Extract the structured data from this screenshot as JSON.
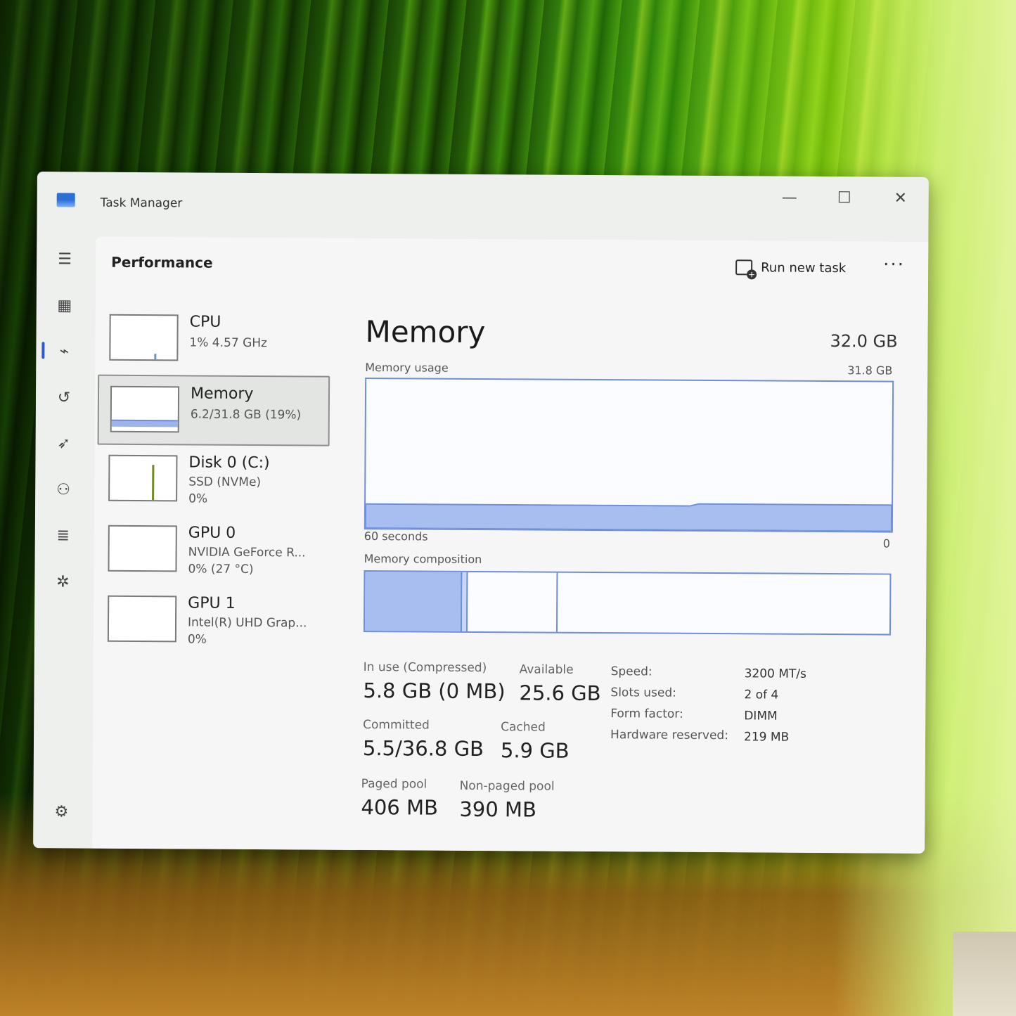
{
  "window": {
    "title": "Task Manager",
    "controls": {
      "minimize": "—",
      "maximize": "☐",
      "close": "✕"
    }
  },
  "nav": {
    "items": [
      {
        "name": "hamburger-menu-icon",
        "glyph": "☰"
      },
      {
        "name": "processes-icon",
        "glyph": "▦"
      },
      {
        "name": "performance-icon",
        "glyph": "⌁"
      },
      {
        "name": "app-history-icon",
        "glyph": "↺"
      },
      {
        "name": "startup-apps-icon",
        "glyph": "➶"
      },
      {
        "name": "users-icon",
        "glyph": "⚇"
      },
      {
        "name": "details-icon",
        "glyph": "≣"
      },
      {
        "name": "services-icon",
        "glyph": "✲"
      },
      {
        "name": "settings-icon",
        "glyph": "⚙"
      }
    ]
  },
  "header": {
    "section": "Performance",
    "run_new_task": "Run new task",
    "more": "···"
  },
  "devices": [
    {
      "name": "CPU",
      "line1": "1% 4.57 GHz",
      "line2": ""
    },
    {
      "name": "Memory",
      "line1": "6.2/31.8 GB (19%)",
      "line2": ""
    },
    {
      "name": "Disk 0 (C:)",
      "line1": "SSD (NVMe)",
      "line2": "0%"
    },
    {
      "name": "GPU 0",
      "line1": "NVIDIA GeForce R...",
      "line2": "0% (27 °C)"
    },
    {
      "name": "GPU 1",
      "line1": "Intel(R) UHD Grap...",
      "line2": "0%"
    }
  ],
  "memory": {
    "title": "Memory",
    "total": "32.0 GB",
    "usage_label": "Memory usage",
    "usage_max": "31.8 GB",
    "axis_left": "60 seconds",
    "axis_right": "0",
    "composition_label": "Memory composition",
    "usage_fraction": 0.19,
    "stats": {
      "in_use_label": "In use (Compressed)",
      "in_use_value": "5.8 GB (0 MB)",
      "available_label": "Available",
      "available_value": "25.6 GB",
      "committed_label": "Committed",
      "committed_value": "5.5/36.8 GB",
      "cached_label": "Cached",
      "cached_value": "5.9 GB",
      "paged_label": "Paged pool",
      "paged_value": "406 MB",
      "nonpaged_label": "Non-paged pool",
      "nonpaged_value": "390 MB"
    },
    "specs": {
      "speed_label": "Speed:",
      "speed_value": "3200 MT/s",
      "slots_label": "Slots used:",
      "slots_value": "2 of 4",
      "form_label": "Form factor:",
      "form_value": "DIMM",
      "hw_label": "Hardware reserved:",
      "hw_value": "219 MB"
    }
  },
  "colors": {
    "accent": "#2a5fc9",
    "memory_line": "#6f8ed8",
    "memory_fill": "#a8bdf0"
  }
}
